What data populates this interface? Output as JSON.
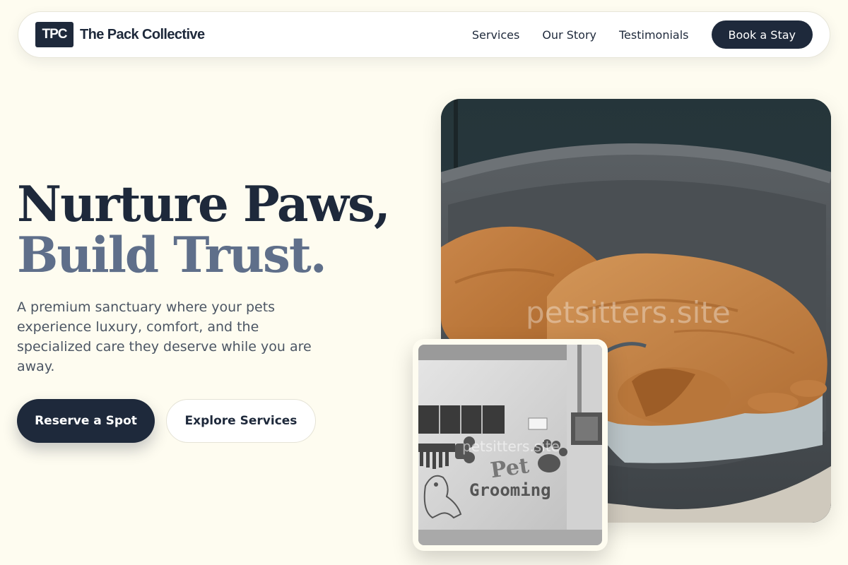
{
  "brand": {
    "logo_text": "TPC",
    "name": "The Pack Collective"
  },
  "nav": {
    "links": [
      "Services",
      "Our Story",
      "Testimonials"
    ],
    "cta_label": "Book a Stay"
  },
  "hero": {
    "title_line1": "Nurture Paws,",
    "title_line2": "Build Trust.",
    "subtitle": "A premium sanctuary where your pets experience luxury, comfort, and the specialized care they deserve while you are away.",
    "primary_button": "Reserve a Spot",
    "secondary_button": "Explore Services"
  },
  "images": {
    "main_watermark": "petsitters.site",
    "inset_watermark": "petsitters.site",
    "inset_sign_line1": "Pet",
    "inset_sign_line2": "Grooming"
  },
  "colors": {
    "background": "#fefcf0",
    "primary": "#1e293b",
    "accent_muted": "#5f6f8a"
  }
}
